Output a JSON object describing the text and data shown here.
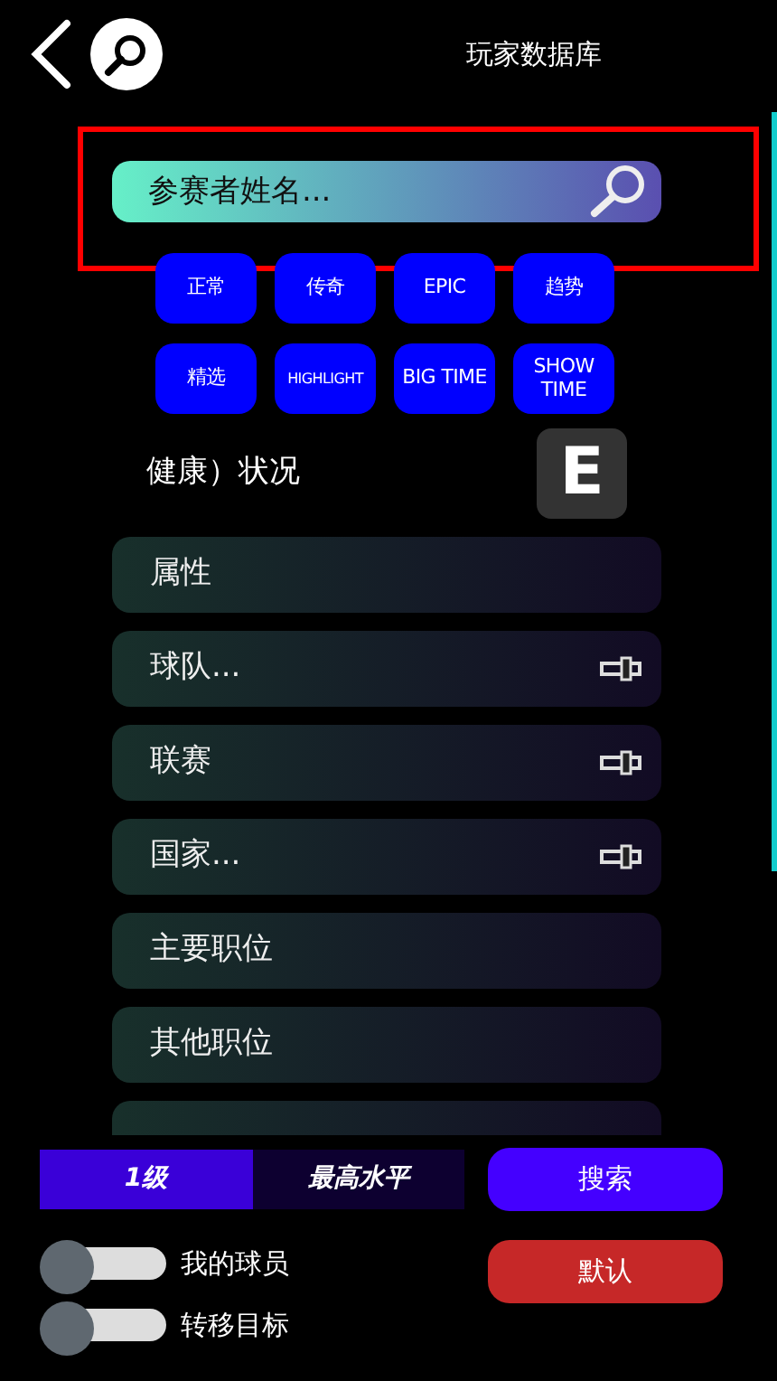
{
  "header": {
    "title": "玩家数据库"
  },
  "search": {
    "placeholder": "参赛者姓名...",
    "highlighted": true
  },
  "chips": [
    {
      "label": "正常",
      "small": false
    },
    {
      "label": "传奇",
      "small": false
    },
    {
      "label": "EPIC",
      "small": false
    },
    {
      "label": "趋势",
      "small": false
    },
    {
      "label": "精选",
      "small": false
    },
    {
      "label": "HIGHLIGHT",
      "small": true
    },
    {
      "label": "BIG TIME",
      "small": false
    },
    {
      "label": "SHOW TIME",
      "small": false
    }
  ],
  "health": {
    "label": "健康）状况",
    "badge": "E"
  },
  "filters": [
    {
      "kind": "row",
      "label": "属性",
      "filter_icon": false
    },
    {
      "kind": "row",
      "label": "球队...",
      "filter_icon": true
    },
    {
      "kind": "row",
      "label": "联赛",
      "filter_icon": true
    },
    {
      "kind": "row",
      "label": "国家...",
      "filter_icon": true
    },
    {
      "kind": "row",
      "label": "主要职位",
      "filter_icon": false
    },
    {
      "kind": "row",
      "label": "其他职位",
      "filter_icon": false
    },
    {
      "kind": "cut"
    }
  ],
  "levels": [
    {
      "label": "1级",
      "selected": true
    },
    {
      "label": "最高水平",
      "selected": false
    }
  ],
  "search_button": "搜索",
  "default_button": "默认",
  "toggles": [
    {
      "label": "我的球员",
      "on": false
    },
    {
      "label": "转移目标",
      "on": false
    }
  ]
}
